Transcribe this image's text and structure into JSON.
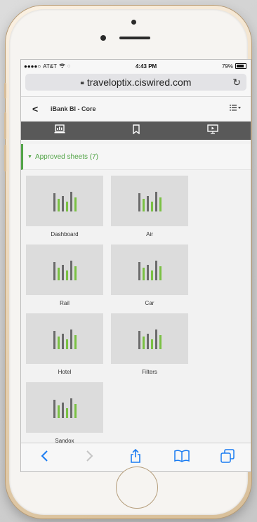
{
  "status": {
    "carrier": "AT&T",
    "time": "4:43 PM",
    "battery": "79%"
  },
  "browser": {
    "url": "traveloptix.ciswired.com"
  },
  "app": {
    "title": "iBank BI - Core"
  },
  "section": {
    "title": "Approved sheets (7)"
  },
  "sheets": [
    {
      "label": "Dashboard"
    },
    {
      "label": "Air"
    },
    {
      "label": "Rail"
    },
    {
      "label": "Car"
    },
    {
      "label": "Hotel"
    },
    {
      "label": "Filters"
    },
    {
      "label": "Sandox"
    }
  ],
  "colors": {
    "accent": "#52a447",
    "bar_green": "#7ac143",
    "bar_gray": "#6b6b6b",
    "toolbar": "#595959",
    "ios_blue": "#1a7cf2"
  }
}
